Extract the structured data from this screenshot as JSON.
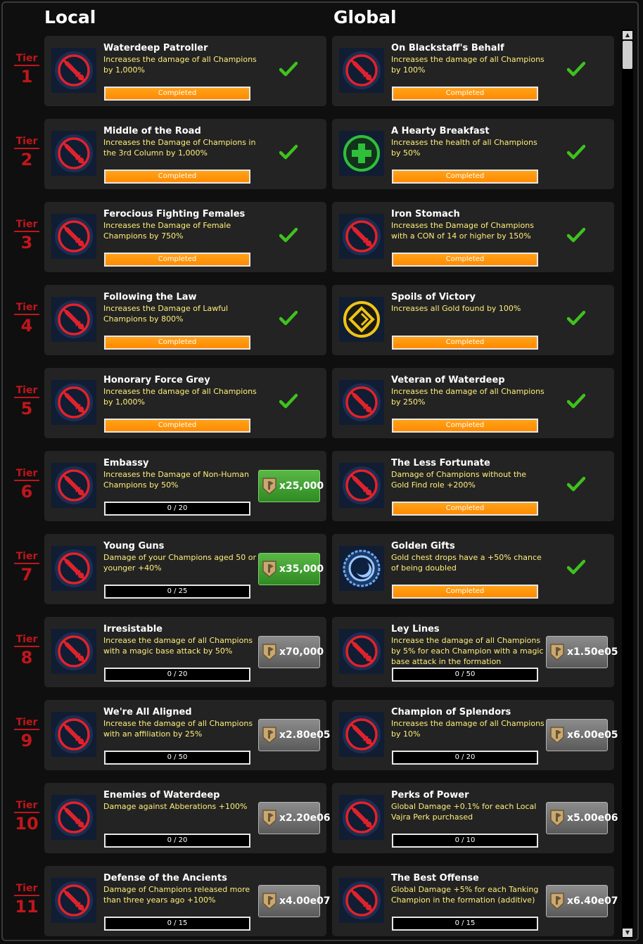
{
  "columns": {
    "local": "Local",
    "global": "Global"
  },
  "tier_word": "Tier",
  "tiers": [
    1,
    2,
    3,
    4,
    5,
    6,
    7,
    8,
    9,
    10,
    11
  ],
  "local": [
    {
      "icon": "sword-icon",
      "title": "Waterdeep Patroller",
      "desc": "Increases the damage of all Champions by 1,000%",
      "status": "completed",
      "bar": "Completed"
    },
    {
      "icon": "sword-icon",
      "title": "Middle of the Road",
      "desc": "Increases the Damage of Champions in the 3rd Column by 1,000%",
      "status": "completed",
      "bar": "Completed"
    },
    {
      "icon": "sword-icon",
      "title": "Ferocious Fighting Females",
      "desc": "Increases the Damage of Female Champions by 750%",
      "status": "completed",
      "bar": "Completed"
    },
    {
      "icon": "sword-icon",
      "title": "Following the Law",
      "desc": "Increases the Damage of Lawful Champions by 800%",
      "status": "completed",
      "bar": "Completed"
    },
    {
      "icon": "sword-icon",
      "title": "Honorary Force Grey",
      "desc": "Increases the damage of all Champions by 1,000%",
      "status": "completed",
      "bar": "Completed"
    },
    {
      "icon": "sword-icon",
      "title": "Embassy",
      "desc": "Increases the Damage of Non-Human Champions by 50%",
      "status": "buy",
      "bar": "0 / 20",
      "cost": "x25,000",
      "cost_style": "green"
    },
    {
      "icon": "sword-icon",
      "title": "Young Guns",
      "desc": "Damage of your Champions aged 50 or younger +40%",
      "status": "buy",
      "bar": "0 / 25",
      "cost": "x35,000",
      "cost_style": "green"
    },
    {
      "icon": "sword-icon",
      "title": "Irresistable",
      "desc": "Increase the damage of all Champions with a magic base attack by 50%",
      "status": "buy",
      "bar": "0 / 20",
      "cost": "x70,000",
      "cost_style": "grey"
    },
    {
      "icon": "sword-icon",
      "title": "We're All Aligned",
      "desc": "Increase the damage of all Champions with an affiliation by 25%",
      "status": "buy",
      "bar": "0 / 50",
      "cost": "x2.80e05",
      "cost_style": "grey"
    },
    {
      "icon": "sword-icon",
      "title": "Enemies of Waterdeep",
      "desc": "Damage against Abberations +100%",
      "status": "buy",
      "bar": "0 / 20",
      "cost": "x2.20e06",
      "cost_style": "grey"
    },
    {
      "icon": "sword-icon",
      "title": "Defense of the Ancients",
      "desc": "Damage of Champions released more than three years ago +100%",
      "status": "buy",
      "bar": "0 / 15",
      "cost": "x4.00e07",
      "cost_style": "grey"
    }
  ],
  "global": [
    {
      "icon": "sword-icon",
      "title": "On Blackstaff's Behalf",
      "desc": "Increases the damage of all Champions by 100%",
      "status": "completed",
      "bar": "Completed"
    },
    {
      "icon": "health-plus-icon",
      "title": "A Hearty Breakfast",
      "desc": "Increases the health of all Champions by 50%",
      "status": "completed",
      "bar": "Completed"
    },
    {
      "icon": "sword-icon",
      "title": "Iron Stomach",
      "desc": "Increases the Damage of Champions with a CON of 14 or higher by 150%",
      "status": "completed",
      "bar": "Completed"
    },
    {
      "icon": "gold-icon",
      "title": "Spoils of Victory",
      "desc": "Increases all Gold found by 100%",
      "status": "completed",
      "bar": "Completed"
    },
    {
      "icon": "sword-icon",
      "title": "Veteran of Waterdeep",
      "desc": "Increases the damage of all Champions by 250%",
      "status": "completed",
      "bar": "Completed"
    },
    {
      "icon": "sword-icon",
      "title": "The Less Fortunate",
      "desc": "Damage of Champions without the Gold Find role +200%",
      "status": "completed",
      "bar": "Completed"
    },
    {
      "icon": "chest-icon",
      "title": "Golden Gifts",
      "desc": "Gold chest drops have a +50% chance of being doubled",
      "status": "completed",
      "bar": "Completed"
    },
    {
      "icon": "sword-icon",
      "title": "Ley Lines",
      "desc": "Increase the damage of all Champions by 5% for each Champion with a magic base attack in the formation",
      "status": "buy",
      "bar": "0 / 50",
      "cost": "x1.50e05",
      "cost_style": "grey"
    },
    {
      "icon": "sword-icon",
      "title": "Champion of Splendors",
      "desc": "Increases the damage of all Champions by 10%",
      "status": "buy",
      "bar": "0 / 20",
      "cost": "x6.00e05",
      "cost_style": "grey"
    },
    {
      "icon": "sword-icon",
      "title": "Perks of Power",
      "desc": "Global Damage +0.1% for each Local Vajra Perk purchased",
      "status": "buy",
      "bar": "0 / 10",
      "cost": "x5.00e06",
      "cost_style": "grey"
    },
    {
      "icon": "sword-icon",
      "title": "The Best Offense",
      "desc": "Global Damage +5% for each Tanking Champion in the formation (additive)",
      "status": "buy",
      "bar": "0 / 15",
      "cost": "x6.40e07",
      "cost_style": "grey"
    }
  ]
}
